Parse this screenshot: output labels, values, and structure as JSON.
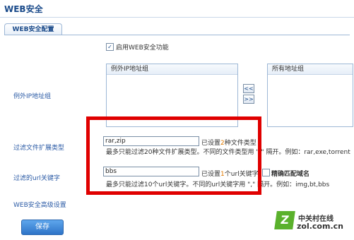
{
  "page": {
    "title": "WEB安全"
  },
  "tab": {
    "label": "WEB安全配置"
  },
  "enable": {
    "checked_glyph": "✓",
    "label": "启用WEB安全功能"
  },
  "exception_ip": {
    "row_label": "例外IP地址组",
    "left_header": "例外IP地址组",
    "btn_left": "<<",
    "btn_right": ">>",
    "right_header": "所有地址组"
  },
  "ext_filter": {
    "row_label": "过滤文件扩展类型",
    "value": "rar,zip",
    "status_prefix": "已设置",
    "status_count": "2",
    "status_suffix": "种文件类型",
    "hint": "最多只能过滤20种文件扩展类型。不同的文件类型用 \",\" 隔开。例如：rar,exe,torrent"
  },
  "url_filter": {
    "row_label": "过滤的url关键字",
    "value": "bbs",
    "status_prefix": "已设置",
    "status_count": "1",
    "status_suffix": "个url关键字",
    "exact_label": "精确匹配域名",
    "hint": "最多只能过滤10个url关键字。不同的url关键字用 \",\" 隔开。例如：img,bt,bbs"
  },
  "advanced": {
    "label": "WEB安全高级设置"
  },
  "save": {
    "label": "保存"
  },
  "watermark": {
    "mark": "Z",
    "name": "中关村在线",
    "url": "zol.com.cn"
  },
  "colors": {
    "highlight": "#e00000",
    "accent": "#2a5aa5",
    "count": "#e07a00",
    "logo": "#5ab12c"
  }
}
